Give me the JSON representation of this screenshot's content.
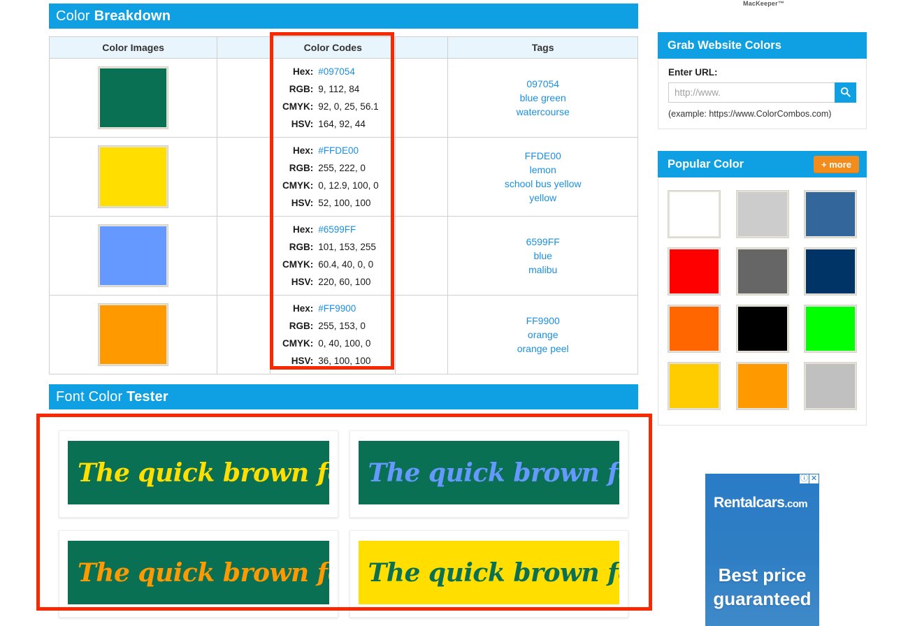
{
  "ads": {
    "top_stub_label": "MacKeeper™",
    "bottom": {
      "info_icon": "info-icon",
      "close_icon": "close-icon",
      "info_glyph": "ⓘ",
      "close_glyph": "✕",
      "brand": "Rentalcars",
      "brand_domain": ".com",
      "headline_line1": "Best price",
      "headline_line2": "guaranteed"
    }
  },
  "breakdown": {
    "title_light": "Color",
    "title_bold": "Breakdown",
    "columns": [
      "Color Images",
      "",
      "Color Codes",
      "",
      "Tags"
    ],
    "labels": {
      "hex": "Hex:",
      "rgb": "RGB:",
      "cmyk": "CMYK:",
      "hsv": "HSV:"
    },
    "rows": [
      {
        "swatch": "#097054",
        "hex": "#097054",
        "rgb": "9, 112, 84",
        "cmyk": "92, 0, 25, 56.1",
        "hsv": "164, 92, 44",
        "tags": [
          "097054",
          "blue green",
          "watercourse"
        ]
      },
      {
        "swatch": "#FFDE00",
        "hex": "#FFDE00",
        "rgb": "255, 222, 0",
        "cmyk": "0, 12.9, 100, 0",
        "hsv": "52, 100, 100",
        "tags": [
          "FFDE00",
          "lemon",
          "school bus yellow",
          "yellow"
        ]
      },
      {
        "swatch": "#6599FF",
        "hex": "#6599FF",
        "rgb": "101, 153, 255",
        "cmyk": "60.4, 40, 0, 0",
        "hsv": "220, 60, 100",
        "tags": [
          "6599FF",
          "blue",
          "malibu"
        ]
      },
      {
        "swatch": "#FF9900",
        "hex": "#FF9900",
        "rgb": "255, 153, 0",
        "cmyk": "0, 40, 100, 0",
        "hsv": "36, 100, 100",
        "tags": [
          "FF9900",
          "orange",
          "orange peel"
        ]
      }
    ]
  },
  "font_tester": {
    "title_light": "Font Color",
    "title_bold": "Tester",
    "sample_text": "The quick brown fox..",
    "samples": [
      {
        "bg": "#097054",
        "fg": "#FFDE00"
      },
      {
        "bg": "#097054",
        "fg": "#6599FF"
      },
      {
        "bg": "#097054",
        "fg": "#FF9900"
      },
      {
        "bg": "#FFDE00",
        "fg": "#097054"
      }
    ]
  },
  "sidebar": {
    "grab": {
      "title": "Grab Website Colors",
      "field_label": "Enter URL:",
      "input_value": "",
      "placeholder": "http://www.",
      "search_icon": "search-icon",
      "hint": "(example: https://www.ColorCombos.com)"
    },
    "popular": {
      "title": "Popular Color",
      "more_label": "+ more",
      "swatches": [
        "#FFFFFF",
        "#CCCCCC",
        "#33669A",
        "#FF0000",
        "#666666",
        "#003366",
        "#FF6600",
        "#000000",
        "#00FF00",
        "#FFCC00",
        "#FF9900",
        "#C0C0C0"
      ]
    }
  },
  "annotations": {
    "accent_color": "#FA2800",
    "boxes": [
      "color-codes-column-highlight",
      "font-tester-panel-highlight"
    ]
  }
}
